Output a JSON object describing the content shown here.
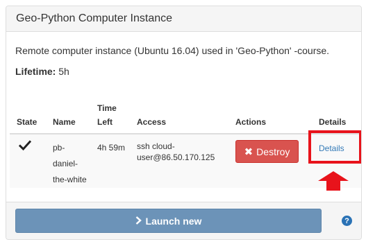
{
  "panel": {
    "title": "Geo-Python Computer Instance",
    "description": "Remote computer instance (Ubuntu 16.04) used in 'Geo-Python' -course.",
    "lifetime_label": "Lifetime:",
    "lifetime_value": "5h"
  },
  "table": {
    "headers": {
      "state": "State",
      "name": "Name",
      "time_left_line1": "Time",
      "time_left_line2": "Left",
      "access": "Access",
      "actions": "Actions",
      "details": "Details"
    },
    "rows": [
      {
        "state_icon": "checkmark-icon",
        "name_line1": "pb-",
        "name_line2": "daniel-",
        "name_line3": "the-white",
        "time_left": "4h 59m",
        "access_line1": "ssh cloud-",
        "access_line2": "user@86.50.170.125",
        "destroy_label": "Destroy",
        "details_label": "Details"
      }
    ]
  },
  "footer": {
    "launch_label": "Launch new",
    "help_symbol": "?"
  },
  "colors": {
    "danger": "#d9534f",
    "primary_muted": "#6c93b8",
    "link": "#337ab7",
    "annotation_red": "#e8131b"
  }
}
